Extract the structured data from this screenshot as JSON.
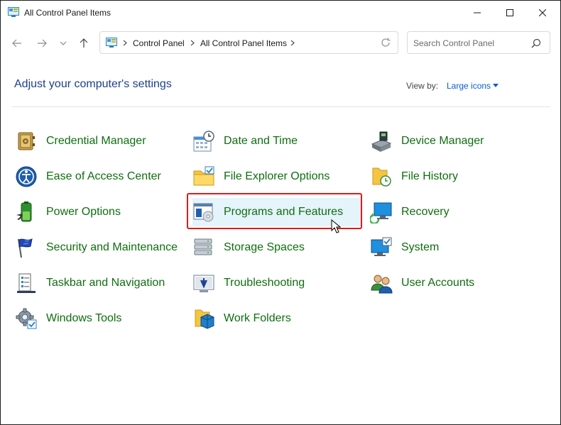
{
  "window": {
    "title": "All Control Panel Items"
  },
  "address": {
    "crumbs": [
      "Control Panel",
      "All Control Panel Items"
    ]
  },
  "search": {
    "placeholder": "Search Control Panel"
  },
  "heading": "Adjust your computer's settings",
  "view_by": {
    "label": "View by:",
    "value": "Large icons"
  },
  "items": [
    {
      "label": "Credential Manager",
      "icon": "vault-icon"
    },
    {
      "label": "Date and Time",
      "icon": "clock-calendar-icon"
    },
    {
      "label": "Device Manager",
      "icon": "device-manager-icon"
    },
    {
      "label": "Ease of Access Center",
      "icon": "ease-of-access-icon"
    },
    {
      "label": "File Explorer Options",
      "icon": "folder-options-icon"
    },
    {
      "label": "File History",
      "icon": "file-history-icon"
    },
    {
      "label": "Power Options",
      "icon": "battery-icon"
    },
    {
      "label": "Programs and Features",
      "icon": "programs-icon"
    },
    {
      "label": "Recovery",
      "icon": "recovery-icon"
    },
    {
      "label": "Security and Maintenance",
      "icon": "flag-icon"
    },
    {
      "label": "Storage Spaces",
      "icon": "storage-icon"
    },
    {
      "label": "System",
      "icon": "monitor-check-icon"
    },
    {
      "label": "Taskbar and Navigation",
      "icon": "taskbar-icon"
    },
    {
      "label": "Troubleshooting",
      "icon": "troubleshoot-icon"
    },
    {
      "label": "User Accounts",
      "icon": "users-icon"
    },
    {
      "label": "Windows Tools",
      "icon": "gear-tools-icon"
    },
    {
      "label": "Work Folders",
      "icon": "work-folders-icon"
    }
  ],
  "colors": {
    "link": "#0f6e0f",
    "heading": "#1e3f8a",
    "accent": "#0b5bd7",
    "highlight": "#e11919"
  }
}
